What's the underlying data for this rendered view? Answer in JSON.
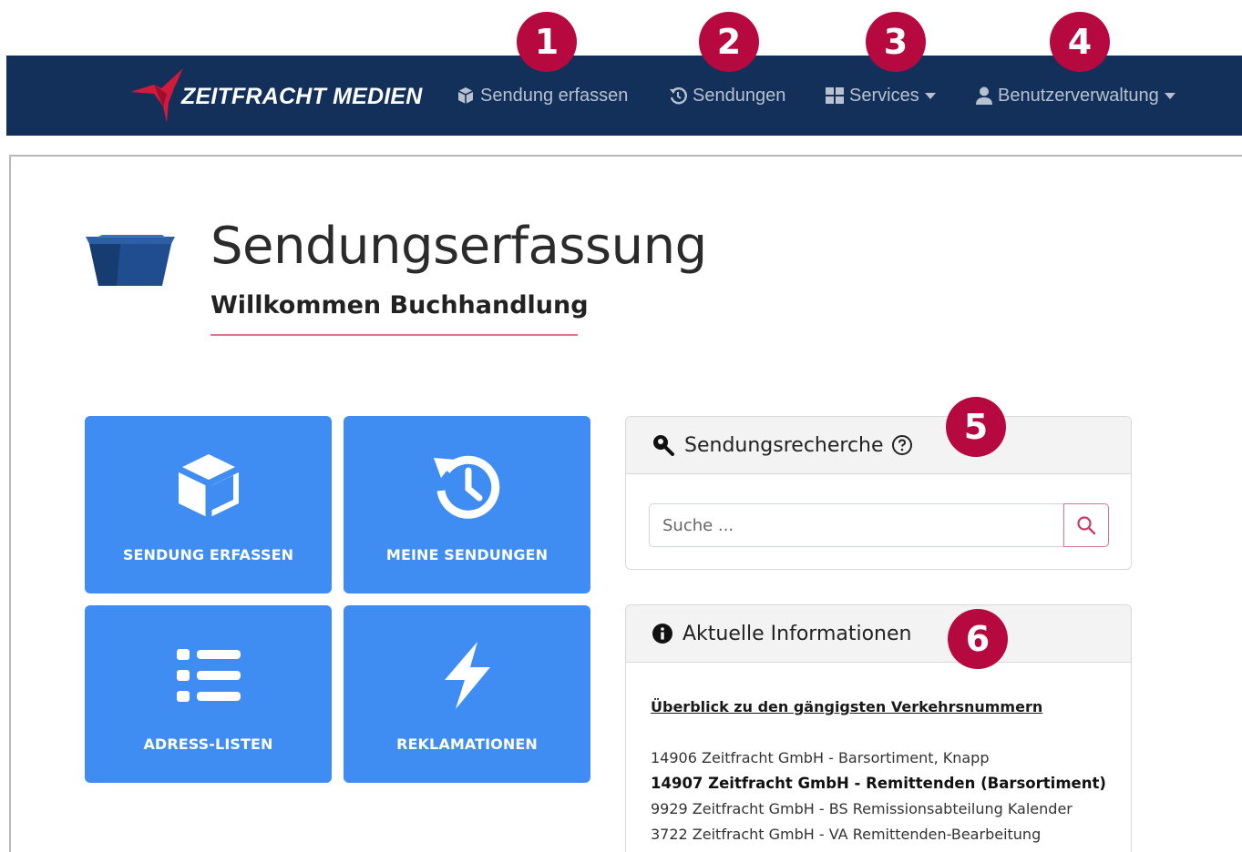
{
  "callouts": [
    "1",
    "2",
    "3",
    "4",
    "5",
    "6"
  ],
  "navbar": {
    "brand": "ZEITFRACHT MEDIEN",
    "items": [
      {
        "label": "Sendung erfassen",
        "icon": "cube-icon"
      },
      {
        "label": "Sendungen",
        "icon": "history-icon"
      },
      {
        "label": "Services",
        "icon": "grid-icon",
        "dropdown": true
      },
      {
        "label": "Benutzerverwaltung",
        "icon": "user-icon",
        "dropdown": true
      }
    ]
  },
  "header": {
    "title": "Sendungserfassung",
    "welcome": "Willkommen Buchhandlung"
  },
  "tiles": [
    {
      "label": "SENDUNG ERFASSEN",
      "icon": "cube-icon"
    },
    {
      "label": "MEINE SENDUNGEN",
      "icon": "history-icon"
    },
    {
      "label": "ADRESS-LISTEN",
      "icon": "list-icon"
    },
    {
      "label": "REKLAMATIONEN",
      "icon": "bolt-icon"
    }
  ],
  "search_card": {
    "title": "Sendungsrecherche",
    "placeholder": "Suche ..."
  },
  "info_card": {
    "title": "Aktuelle Informationen",
    "link": "Überblick zu den gängigsten Verkehrsnummern",
    "lines": [
      {
        "text": "14906 Zeitfracht GmbH - Barsortiment, Knapp",
        "bold": false
      },
      {
        "text": "14907 Zeitfracht GmbH - Remittenden (Barsortiment)",
        "bold": true
      },
      {
        "text": "9929 Zeitfracht GmbH - BS Remissionsabteilung Kalender",
        "bold": false
      },
      {
        "text": "3722 Zeitfracht GmbH - VA Remittenden-Bearbeitung",
        "bold": false
      }
    ]
  },
  "colors": {
    "navbar": "#12305a",
    "tile": "#3f8cf3",
    "callout": "#b5093f",
    "accent_underline": "#e07590"
  }
}
